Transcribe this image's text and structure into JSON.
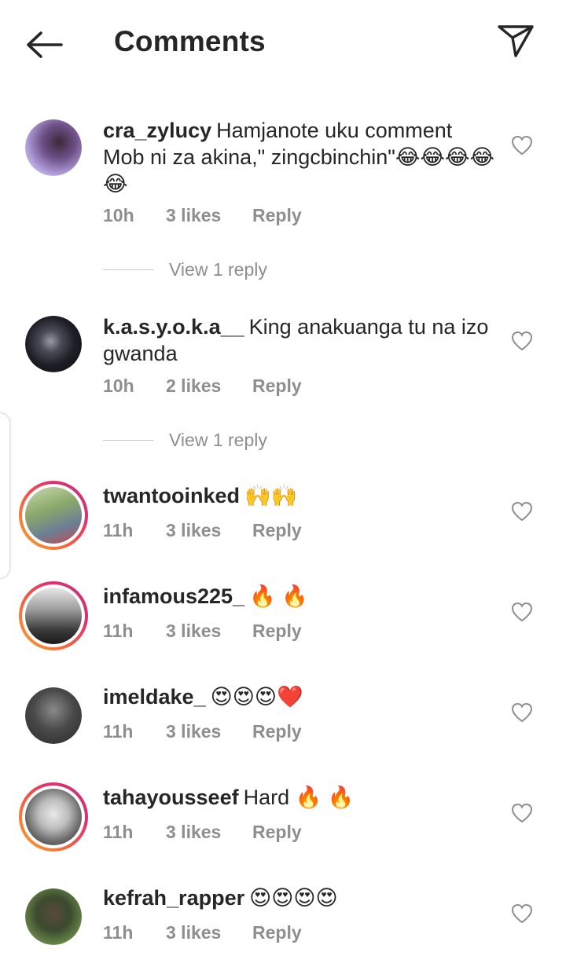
{
  "header": {
    "title": "Comments",
    "back_icon": "arrow-left-icon",
    "share_icon": "paper-plane-icon"
  },
  "colors": {
    "text": "#262626",
    "meta": "#8e8e8e",
    "divider": "#c7c7c7",
    "story_ring": [
      "#f9a825",
      "#e1306c",
      "#c13584"
    ]
  },
  "comments": [
    {
      "username": "cra_zylucy",
      "text": "Hamjanote uku comment Mob ni za akina,\" zingcbinchin\"😂😂😂😂😂",
      "time": "10h",
      "likes": "3 likes",
      "reply_label": "Reply",
      "view_replies": "View 1 reply",
      "story_ring": false
    },
    {
      "username": "k.a.s.y.o.k.a__",
      "text": "King anakuanga tu na izo gwanda",
      "time": "10h",
      "likes": "2 likes",
      "reply_label": "Reply",
      "view_replies": "View 1 reply",
      "story_ring": false
    },
    {
      "username": "twantooinked",
      "text": "🙌🙌",
      "time": "11h",
      "likes": "3 likes",
      "reply_label": "Reply",
      "story_ring": true
    },
    {
      "username": "infamous225_",
      "text": "🔥 🔥",
      "time": "11h",
      "likes": "3 likes",
      "reply_label": "Reply",
      "story_ring": true
    },
    {
      "username": "imeldake_",
      "text": "😍😍😍❤️",
      "time": "11h",
      "likes": "3 likes",
      "reply_label": "Reply",
      "story_ring": false
    },
    {
      "username": "tahayousseef",
      "text": "Hard 🔥 🔥",
      "time": "11h",
      "likes": "3 likes",
      "reply_label": "Reply",
      "story_ring": true
    },
    {
      "username": "kefrah_rapper",
      "text": "😍😍😍😍",
      "time": "11h",
      "likes": "3 likes",
      "reply_label": "Reply",
      "story_ring": false
    }
  ]
}
